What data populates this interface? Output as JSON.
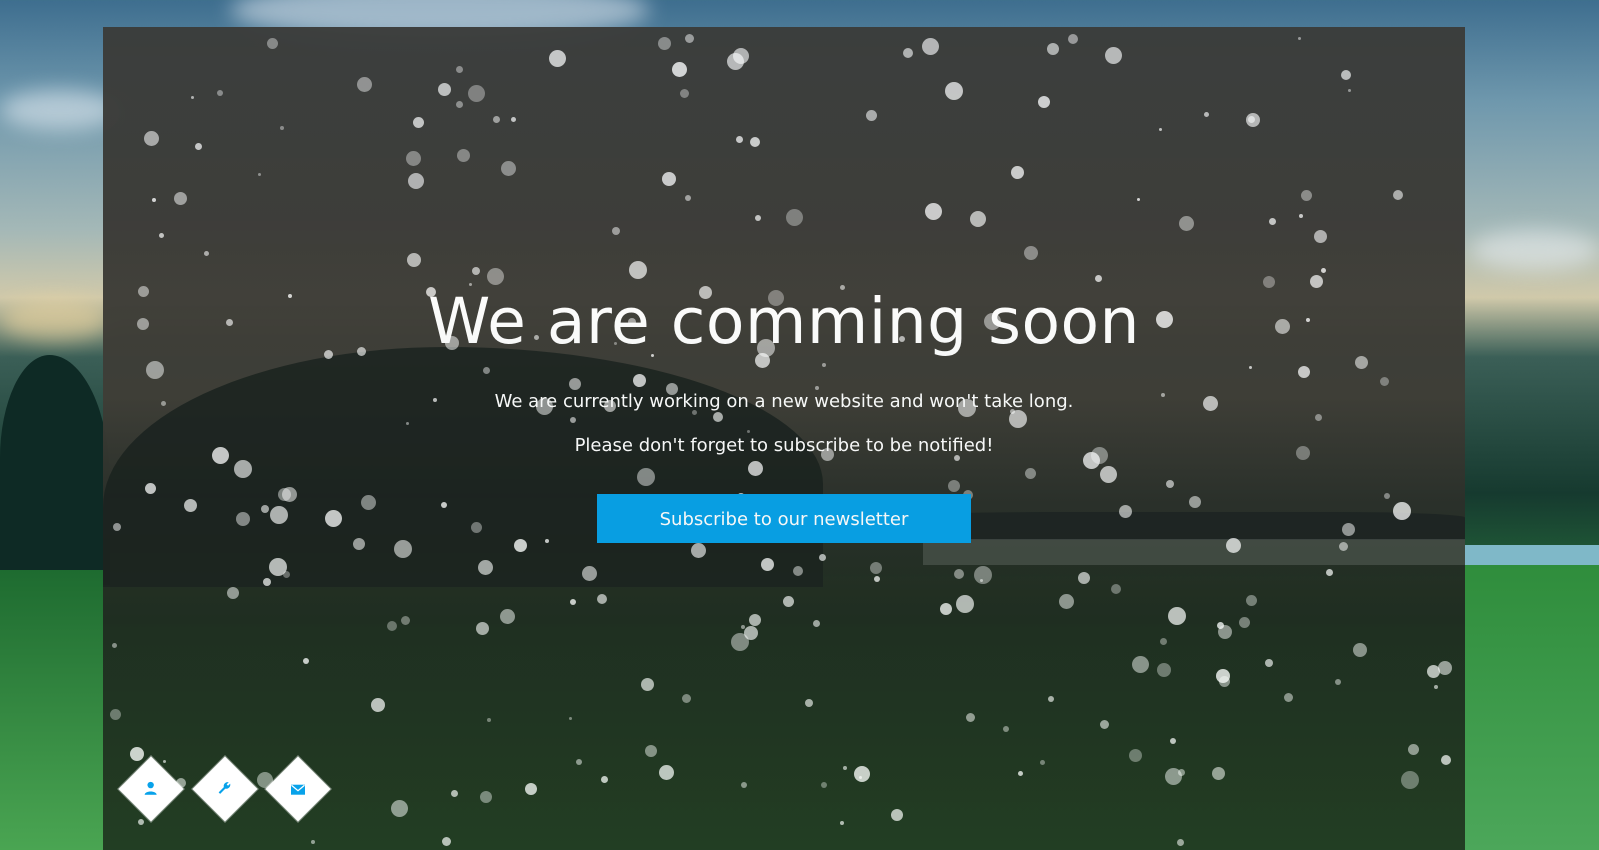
{
  "hero": {
    "headline": "We are comming soon",
    "line1": "We are currently working on a new website and won't take long.",
    "line2": "Please don't forget to subscribe to be notified!",
    "cta_label": "Subscribe to our newsletter"
  },
  "social_links": [
    {
      "icon": "user-icon"
    },
    {
      "icon": "wrench-icon"
    },
    {
      "icon": "envelope-icon"
    }
  ],
  "colors": {
    "accent": "#08a2ea",
    "text": "#ffffff"
  }
}
